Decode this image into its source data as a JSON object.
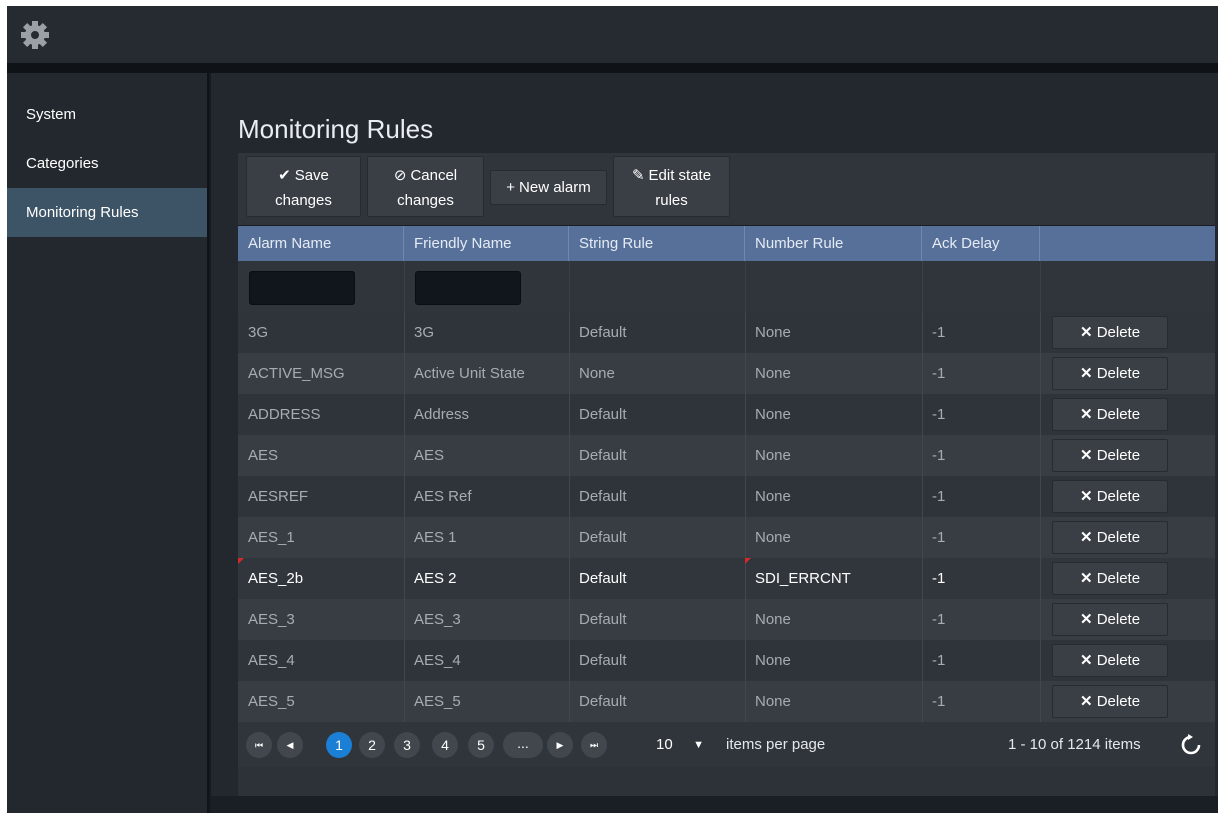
{
  "topbar": {
    "settings_icon": "gear-icon"
  },
  "sidebar": {
    "items": [
      {
        "label": "System",
        "active": false
      },
      {
        "label": "Categories",
        "active": false
      },
      {
        "label": "Monitoring Rules",
        "active": true
      }
    ]
  },
  "page": {
    "title": "Monitoring Rules"
  },
  "toolbar": {
    "save_line1": "Save",
    "save_line2": "changes",
    "cancel_line1": "Cancel",
    "cancel_line2": "changes",
    "new_alarm": "New alarm",
    "edit_line1": "Edit state",
    "edit_line2": "rules"
  },
  "table": {
    "headers": [
      "Alarm Name",
      "Friendly Name",
      "String Rule",
      "Number Rule",
      "Ack Delay",
      ""
    ],
    "delete_label": "Delete",
    "rows": [
      {
        "alarm": "3G",
        "friendly": "3G",
        "string_rule": "Default",
        "number_rule": "None",
        "ack": "-1",
        "modified": false
      },
      {
        "alarm": "ACTIVE_MSG",
        "friendly": "Active Unit State",
        "string_rule": "None",
        "number_rule": "None",
        "ack": "-1",
        "modified": false
      },
      {
        "alarm": "ADDRESS",
        "friendly": "Address",
        "string_rule": "Default",
        "number_rule": "None",
        "ack": "-1",
        "modified": false
      },
      {
        "alarm": "AES",
        "friendly": "AES",
        "string_rule": "Default",
        "number_rule": "None",
        "ack": "-1",
        "modified": false
      },
      {
        "alarm": "AESREF",
        "friendly": "AES Ref",
        "string_rule": "Default",
        "number_rule": "None",
        "ack": "-1",
        "modified": false
      },
      {
        "alarm": "AES_1",
        "friendly": "AES 1",
        "string_rule": "Default",
        "number_rule": "None",
        "ack": "-1",
        "modified": false
      },
      {
        "alarm": "AES_2b",
        "friendly": "AES 2",
        "string_rule": "Default",
        "number_rule": "SDI_ERRCNT",
        "ack": "-1",
        "modified": true
      },
      {
        "alarm": "AES_3",
        "friendly": "AES_3",
        "string_rule": "Default",
        "number_rule": "None",
        "ack": "-1",
        "modified": false
      },
      {
        "alarm": "AES_4",
        "friendly": "AES_4",
        "string_rule": "Default",
        "number_rule": "None",
        "ack": "-1",
        "modified": false
      },
      {
        "alarm": "AES_5",
        "friendly": "AES_5",
        "string_rule": "Default",
        "number_rule": "None",
        "ack": "-1",
        "modified": false
      }
    ]
  },
  "pager": {
    "pages": [
      "1",
      "2",
      "3",
      "4",
      "5",
      "..."
    ],
    "current_page": "1",
    "page_size": "10",
    "items_per_page_label": "items per page",
    "range_text": "1 - 10 of 1214 items"
  },
  "colors": {
    "header_bg": "#56709a",
    "active_page": "#1b7fd6",
    "sidebar_active": "#3d5366",
    "modified_flag": "#d22a2a"
  }
}
